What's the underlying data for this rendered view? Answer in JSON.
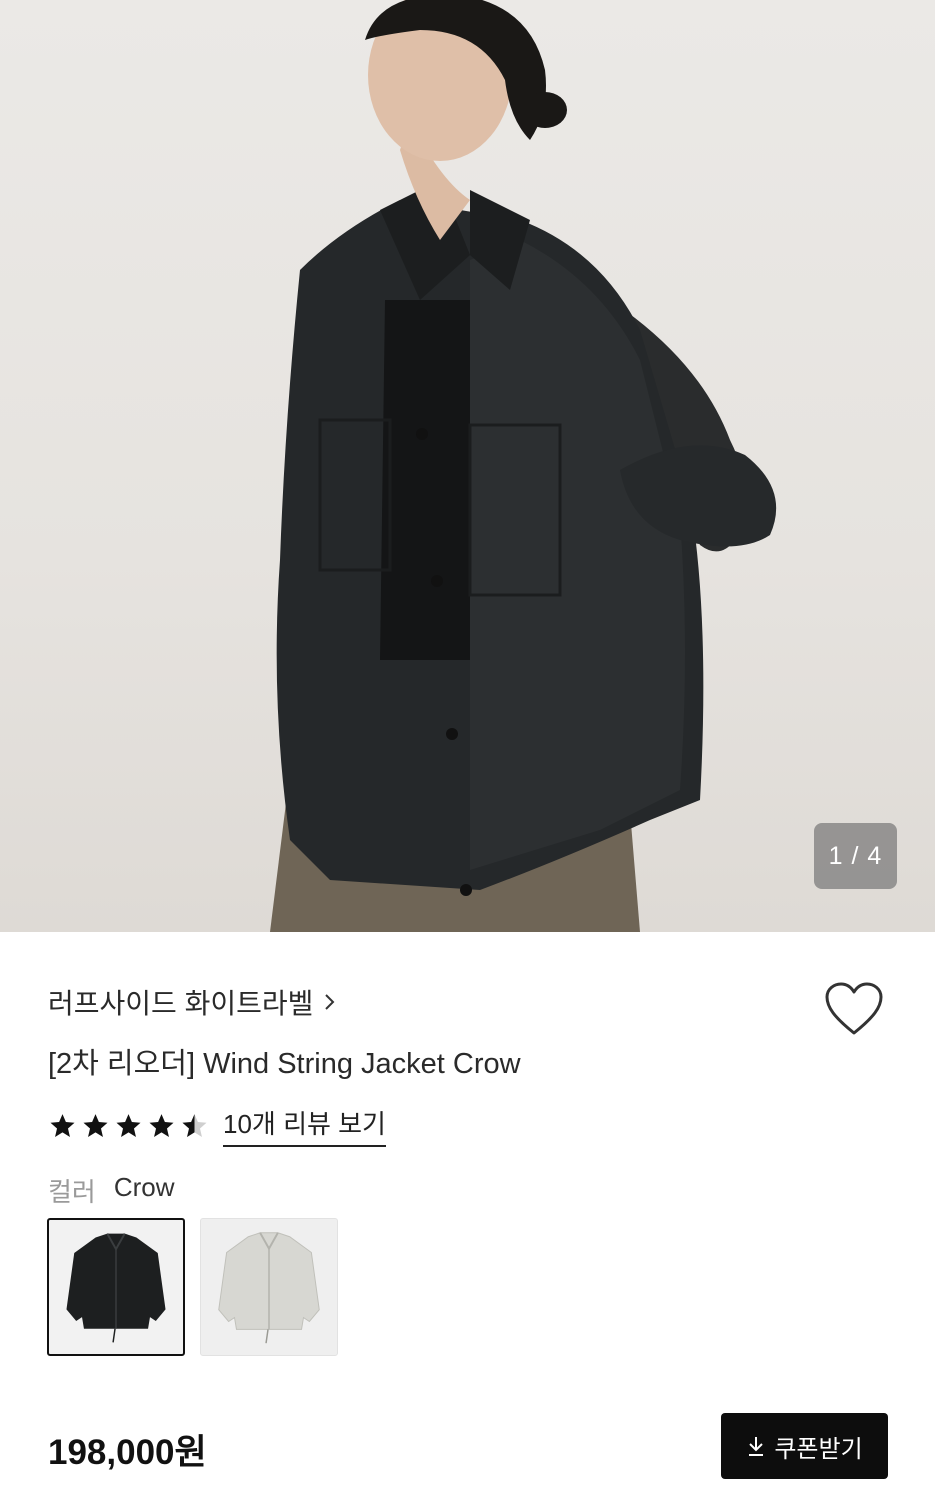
{
  "gallery": {
    "counter": "1 / 4"
  },
  "product": {
    "brand": "러프사이드 화이트라벨",
    "title": "[2차 리오더] Wind String Jacket Crow",
    "rating": 4.5,
    "review_link": "10개 리뷰 보기",
    "color_label": "컬러",
    "color_value": "Crow",
    "price": "198,000원"
  },
  "coupon_button": {
    "label": "쿠폰받기",
    "icon": "download-icon"
  },
  "icons": {
    "brand_link": "chevron-right-icon",
    "wishlist": "heart-icon",
    "rating": "star-icon"
  },
  "colors": {
    "button_bg": "#0d0d0d",
    "selected_border": "#111111",
    "star": "#111111"
  }
}
